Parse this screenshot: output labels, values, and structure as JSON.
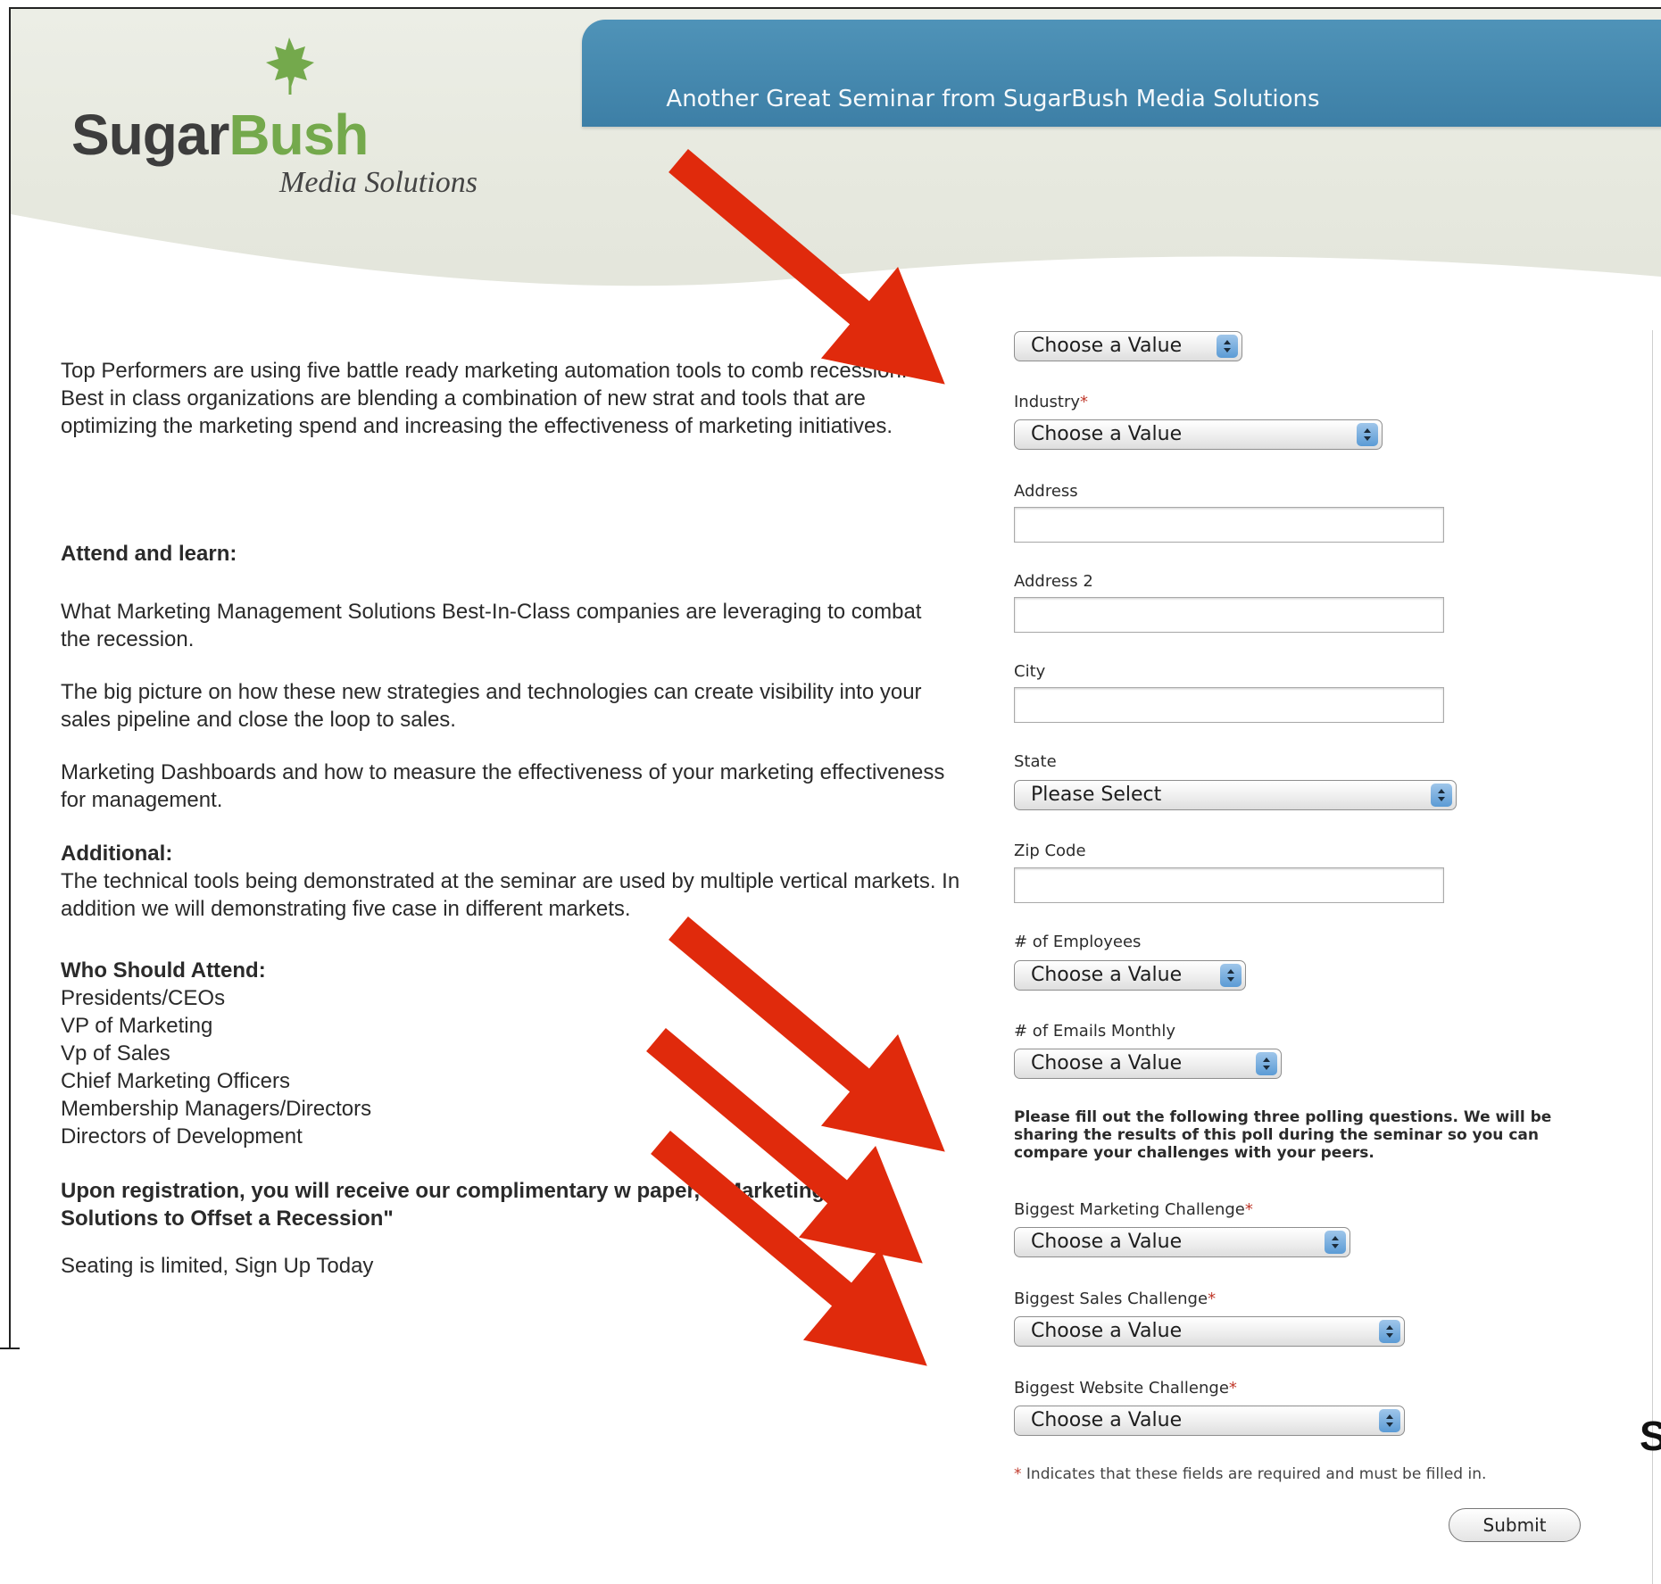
{
  "header": {
    "tagline": "Another Great Seminar from SugarBush Media Solutions",
    "logo": {
      "word_a": "Sugar",
      "word_b": "Bush",
      "subtitle": "Media Solutions"
    }
  },
  "left": {
    "intro": "Top Performers are using five battle ready marketing automation tools to comb recession. Best in class organizations are blending a combination of new strat and tools that are optimizing the marketing spend and increasing the effectiveness of marketing initiatives.",
    "attend_heading": "Attend and learn:",
    "learn_points": [
      "What Marketing Management Solutions Best-In-Class companies are leveraging to combat the recession.",
      "The big picture on how these new strategies and technologies can create visibility into your sales pipeline and close the loop to sales.",
      "Marketing Dashboards and how to measure the effectiveness of your marketing effectiveness for management."
    ],
    "additional_heading": "Additional:",
    "additional_text": "The technical tools being demonstrated at the seminar are used by multiple vertical markets. In addition we will demonstrating five case in different markets.",
    "who_heading": "Who Should Attend:",
    "who_list": [
      "Presidents/CEOs",
      "VP of Marketing",
      "Vp of Sales",
      "Chief Marketing Officers",
      "Membership Managers/Directors",
      "Directors of Development"
    ],
    "registration_text": "Upon registration, you will receive our complimentary w paper, e Marketing Solutions to Offset a Recession\"",
    "seating_text": "Seating is limited, Sign Up Today"
  },
  "form": {
    "top_select": "Choose a Value",
    "industry_label": "Industry",
    "industry_select": "Choose a Value",
    "address_label": "Address",
    "address_value": "",
    "address2_label": "Address 2",
    "address2_value": "",
    "city_label": "City",
    "city_value": "",
    "state_label": "State",
    "state_select": "Please Select",
    "zip_label": "Zip Code",
    "zip_value": "",
    "employees_label": "# of Employees",
    "employees_select": "Choose a Value",
    "emails_label": "# of Emails Monthly",
    "emails_select": "Choose a Value",
    "poll_intro": "Please fill out the following three polling questions. We will be sharing the results of this poll during the seminar so you can compare your challenges with your peers.",
    "marketing_label": "Biggest Marketing Challenge",
    "marketing_select": "Choose a Value",
    "sales_label": "Biggest Sales Challenge",
    "sales_select": "Choose a Value",
    "website_label": "Biggest Website Challenge",
    "website_select": "Choose a Value",
    "required_marker": "*",
    "required_note": "Indicates that these fields are required and must be filled in.",
    "submit_label": "Submit"
  },
  "cut_off_letter": "S",
  "colors": {
    "banner": "#3d7fa6",
    "logo_green": "#74a94c",
    "arrow_red": "#e02a0c",
    "required": "#c0392b"
  },
  "icons": [
    "maple-leaf-icon",
    "select-arrows-icon",
    "red-arrow-annotation"
  ]
}
